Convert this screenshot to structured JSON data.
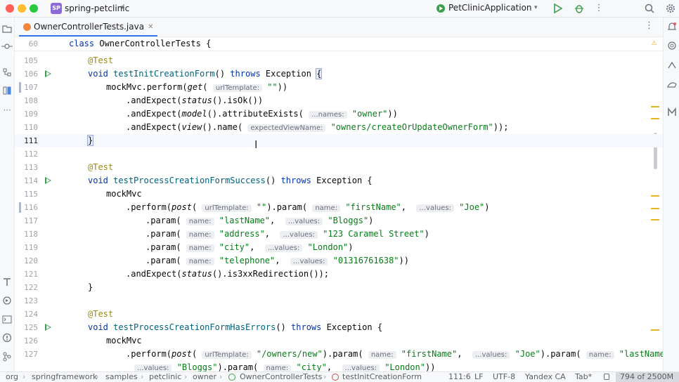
{
  "titlebar": {
    "project_badge": "SP",
    "project_name": "spring-petclinic",
    "run_config": "PetClinicApplication"
  },
  "tab": {
    "label": "OwnerControllerTests.java"
  },
  "sticky": {
    "line": "60",
    "code": "class OwnerControllerTests {"
  },
  "lines": [
    "105",
    "106",
    "107",
    "108",
    "109",
    "110",
    "111",
    "112",
    "113",
    "114",
    "115",
    "116",
    "117",
    "118",
    "119",
    "120",
    "121",
    "122",
    "123",
    "124",
    "125",
    "126",
    "127"
  ],
  "code": {
    "test_annotation": "@Test",
    "kw_void": "void",
    "kw_throws": "throws",
    "exception": "Exception",
    "m1": "testInitCreationForm",
    "m2": "testProcessCreationFormSuccess",
    "m3": "testProcessCreationFormHasErrors",
    "mockMvc": "mockMvc",
    "perform": ".perform(",
    "perform_obj": "mockMvc.perform(",
    "get": "get",
    "post": "post",
    "status": "status",
    "model": "model",
    "view": "view",
    "hint_url": "urlTemplate:",
    "hint_names": "...names:",
    "hint_view": "expectedViewName:",
    "hint_name": "name:",
    "hint_values": "...values:",
    "s_empty": "\"\"",
    "s_owner": "\"owner\"",
    "s_view": "\"owners/createOrUpdateOwnerForm\"",
    "s_firstName": "\"firstName\"",
    "s_joe": "\"Joe\"",
    "s_lastName": "\"lastName\"",
    "s_bloggs": "\"Bloggs\"",
    "s_address": "\"address\"",
    "s_addr_val": "\"123 Caramel Street\"",
    "s_city": "\"city\"",
    "s_london": "\"London\"",
    "s_telephone": "\"telephone\"",
    "s_phone": "\"01316761638\"",
    "s_owners_new": "\"/owners/new\""
  },
  "status": {
    "breadcrumb": [
      "org",
      "springframework",
      "samples",
      "petclinic",
      "owner",
      "OwnerControllerTests",
      "testInitCreationForm"
    ],
    "position": "111:6",
    "line_sep": "LF",
    "encoding": "UTF-8",
    "formatter": "Yandex CA",
    "indent": "Tab*",
    "memory": "794 of 2500M"
  },
  "colors": {
    "accent": "#3574f0",
    "keyword": "#0033b3",
    "string": "#067d17",
    "annotation": "#9e880d"
  }
}
